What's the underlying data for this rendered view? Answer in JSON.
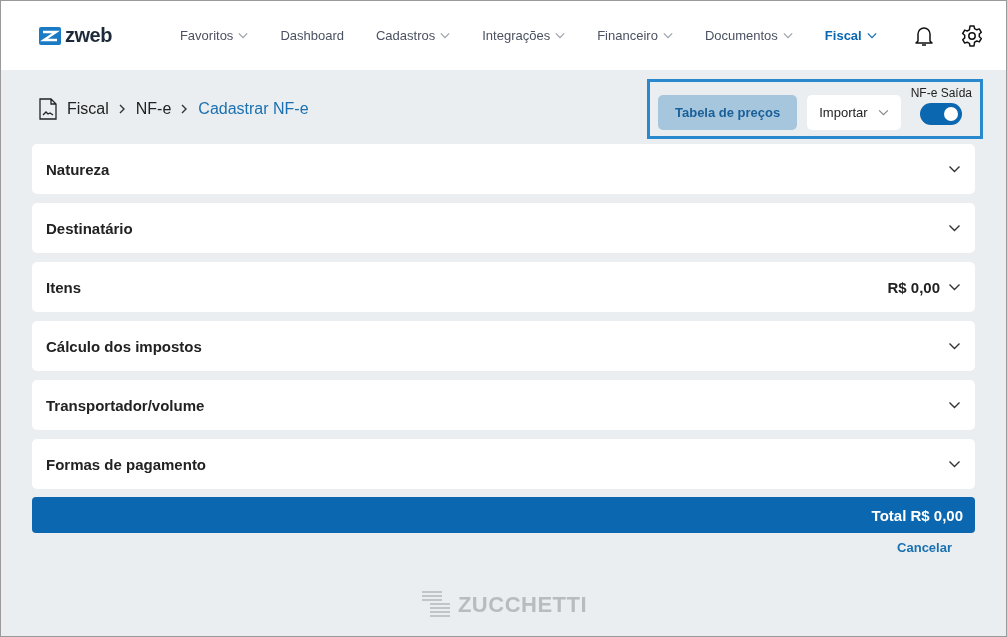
{
  "logo": {
    "text": "zweb"
  },
  "nav": [
    {
      "label": "Favoritos",
      "dropdown": true,
      "selected": false
    },
    {
      "label": "Dashboard",
      "dropdown": false,
      "selected": false
    },
    {
      "label": "Cadastros",
      "dropdown": true,
      "selected": false
    },
    {
      "label": "Integrações",
      "dropdown": true,
      "selected": false
    },
    {
      "label": "Financeiro",
      "dropdown": true,
      "selected": false
    },
    {
      "label": "Documentos",
      "dropdown": true,
      "selected": false
    },
    {
      "label": "Fiscal",
      "dropdown": true,
      "selected": true
    }
  ],
  "breadcrumb": [
    {
      "label": "Fiscal",
      "current": false
    },
    {
      "label": "NF-e",
      "current": false
    },
    {
      "label": "Cadastrar NF-e",
      "current": true
    }
  ],
  "actions": {
    "price_table_button": "Tabela de preços",
    "import_button": "Importar",
    "toggle": {
      "label": "NF-e Saída",
      "on": true
    }
  },
  "sections": [
    {
      "title": "Natureza"
    },
    {
      "title": "Destinatário"
    },
    {
      "title": "Itens",
      "amount": "R$ 0,00"
    },
    {
      "title": "Cálculo dos impostos"
    },
    {
      "title": "Transportador/volume"
    },
    {
      "title": "Formas de pagamento"
    }
  ],
  "total": "Total R$ 0,00",
  "cancel": "Cancelar",
  "footer_logo": "ZUCCHETTI"
}
